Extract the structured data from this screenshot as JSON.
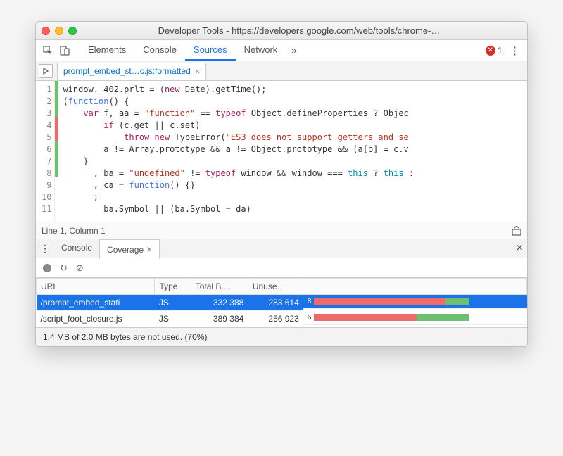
{
  "window": {
    "title": "Developer Tools - https://developers.google.com/web/tools/chrome-…"
  },
  "toolbar": {
    "tabs": [
      "Elements",
      "Console",
      "Sources",
      "Network"
    ],
    "more_glyph": "»",
    "active_index": 2,
    "errors": {
      "count": "1"
    },
    "menu_glyph": "⋮"
  },
  "filetab": {
    "name": "prompt_embed_st…c.js:formatted",
    "close": "×"
  },
  "code": {
    "lines": [
      {
        "n": "1",
        "hl": "green",
        "segs": [
          [
            "",
            "window._402.prlt = ("
          ],
          [
            "kw",
            "new"
          ],
          [
            "",
            " Date).getTime();"
          ]
        ]
      },
      {
        "n": "2",
        "hl": "green",
        "segs": [
          [
            "",
            "("
          ],
          [
            "kw2",
            "function"
          ],
          [
            "",
            "() {"
          ]
        ]
      },
      {
        "n": "3",
        "hl": "green",
        "segs": [
          [
            "",
            "    "
          ],
          [
            "kw",
            "var"
          ],
          [
            "",
            " f, aa = "
          ],
          [
            "str",
            "\"function\""
          ],
          [
            "",
            " == "
          ],
          [
            "kw",
            "typeof"
          ],
          [
            "",
            " Object.defineProperties ? Objec"
          ]
        ]
      },
      {
        "n": "4",
        "hl": "red",
        "segs": [
          [
            "",
            "        "
          ],
          [
            "kw",
            "if"
          ],
          [
            "",
            " (c.get || c.set)"
          ]
        ]
      },
      {
        "n": "5",
        "hl": "red",
        "segs": [
          [
            "",
            "            "
          ],
          [
            "kw",
            "throw new"
          ],
          [
            "",
            " TypeError("
          ],
          [
            "str",
            "\"ES3 does not support getters and se"
          ]
        ]
      },
      {
        "n": "6",
        "hl": "green",
        "segs": [
          [
            "",
            "        a != Array.prototype && a != Object.prototype && (a[b] = c.v"
          ]
        ]
      },
      {
        "n": "7",
        "hl": "green",
        "segs": [
          [
            "",
            "    }"
          ]
        ]
      },
      {
        "n": "8",
        "hl": "green",
        "segs": [
          [
            "",
            "      , ba = "
          ],
          [
            "str",
            "\"undefined\""
          ],
          [
            "",
            " != "
          ],
          [
            "kw",
            "typeof"
          ],
          [
            "",
            " window && window === "
          ],
          [
            "this",
            "this"
          ],
          [
            "",
            " ? "
          ],
          [
            "this",
            "this"
          ],
          [
            "",
            " :"
          ]
        ]
      },
      {
        "n": "9",
        "hl": "",
        "segs": [
          [
            "",
            "      , ca = "
          ],
          [
            "kw2",
            "function"
          ],
          [
            "",
            "() {}"
          ]
        ]
      },
      {
        "n": "10",
        "hl": "",
        "segs": [
          [
            "",
            "      ;"
          ]
        ]
      },
      {
        "n": "11",
        "hl": "",
        "segs": [
          [
            "",
            "        ba.Symbol || (ba.Symbol = da)"
          ]
        ]
      }
    ]
  },
  "status": {
    "pos": "Line 1, Column 1"
  },
  "drawer": {
    "tabs": [
      "Console",
      "Coverage"
    ],
    "active_index": 1,
    "menu_glyph": "⋮",
    "close": "×"
  },
  "coverage": {
    "columns": [
      "URL",
      "Type",
      "Total B…",
      "Unuse…"
    ],
    "rows": [
      {
        "url": "/prompt_embed_stati",
        "type": "JS",
        "total": "332 388",
        "unused": "283 614",
        "extra": "8",
        "usedPct": 15,
        "unusedPct": 85,
        "selected": true
      },
      {
        "url": "/script_foot_closure.js",
        "type": "JS",
        "total": "389 384",
        "unused": "256 923",
        "extra": "6",
        "usedPct": 34,
        "unusedPct": 66,
        "selected": false
      }
    ],
    "footer": "1.4 MB of 2.0 MB bytes are not used. (70%)"
  },
  "colors": {
    "used": "#6ec071",
    "unused": "#ef6b6b",
    "accent": "#1a73e8"
  }
}
